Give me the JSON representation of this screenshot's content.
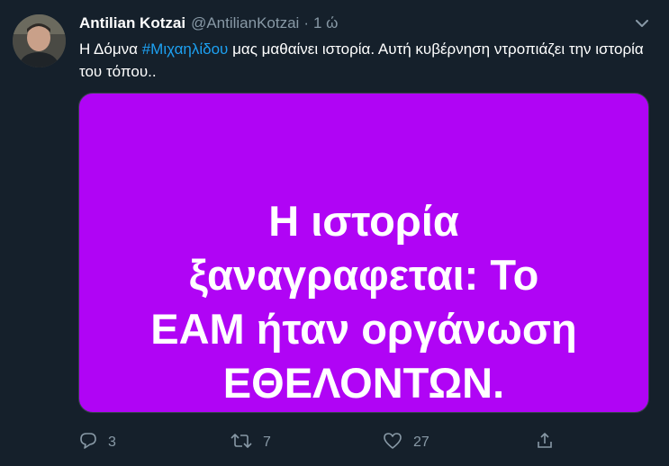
{
  "tweet": {
    "author_name": "Antilian Kotzai",
    "author_handle": "@AntilianKotzai",
    "separator": "·",
    "time": "1 ώ",
    "text_before": "Η Δόμνα ",
    "hashtag": "#Μιχαηλίδου",
    "text_after": " μας μαθαίνει ιστορία. Αυτή κυβέρνηση ντροπιάζει την ιστορία του τόπου..",
    "media": {
      "background": "#b004f5",
      "lines": [
        "Η ιστορία",
        "ξαναγραφεται: Το",
        "ΕΑΜ ήταν οργάνωση",
        "ΕΘΕΛΟΝΤΩΝ."
      ]
    }
  },
  "actions": {
    "replies": "3",
    "retweets": "7",
    "likes": "27"
  },
  "icons": {
    "reply": "reply-icon",
    "retweet": "retweet-icon",
    "like": "heart-icon",
    "share": "share-icon",
    "menu": "chevron-down-icon"
  },
  "colors": {
    "background": "#15202b",
    "secondary_text": "#8899a6",
    "accent": "#1da1f2"
  }
}
